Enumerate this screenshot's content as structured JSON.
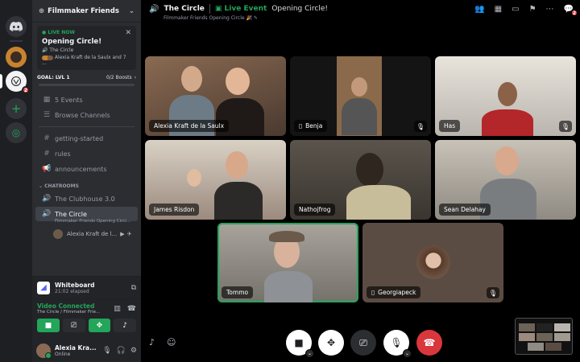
{
  "server": {
    "name": "Filmmaker Friends",
    "mention_count": "2"
  },
  "live_card": {
    "status": "LIVE NOW",
    "title": "Opening Circle!",
    "channel": "The Circle",
    "attendees": "Alexia Kraft de la Saulx and 7 ..."
  },
  "goal": {
    "label": "GOAL: LVL 1",
    "boosts": "0/2 Boosts"
  },
  "sidebar": {
    "events": "5 Events",
    "browse": "Browse Channels",
    "channels": [
      "getting-started",
      "rules",
      "announcements"
    ],
    "category": "CHATROOMS",
    "voice": [
      {
        "name": "The Clubhouse 3.0"
      },
      {
        "name": "The Circle",
        "subtitle": "Filmmaker Friends Opening Circl...",
        "member": "Alexia Kraft de l..."
      }
    ]
  },
  "whiteboard": {
    "title": "Whiteboard",
    "elapsed": "21:02 elapsed"
  },
  "voice_status": {
    "title": "Video Connected",
    "location": "The Circle / Filmmaker Frie..."
  },
  "user": {
    "name": "Alexia Kra...",
    "status": "Online"
  },
  "header": {
    "channel": "The Circle",
    "event_tag": "Live Event",
    "event_name": "Opening Circle!",
    "subtitle": "Filmmaker Friends Opening Circle 🎉",
    "inbox_count": "2"
  },
  "participants": [
    {
      "name": "Alexia Kraft de la Saulx",
      "bg": "#7a5a45"
    },
    {
      "name": "Benja",
      "bg": "#8a6a4a"
    },
    {
      "name": "Has",
      "bg": "#b9b5ae"
    },
    {
      "name": "James Risdon",
      "bg": "#9c8a7e"
    },
    {
      "name": "Nathojfrog",
      "bg": "#6a6258"
    },
    {
      "name": "Sean Delahay",
      "bg": "#a09a90"
    },
    {
      "name": "Tommo",
      "bg": "#8f8b84"
    },
    {
      "name": "Georgiapeck",
      "bg": "#5b4c43"
    }
  ],
  "icons": {
    "mute": "mic-off-icon",
    "camera": "camera-icon",
    "activities": "activities-icon",
    "screenshare": "screen-share-icon",
    "mic": "microphone-icon",
    "hangup": "hang-up-icon"
  },
  "colors": {
    "accent_green": "#23a55a",
    "danger": "#da373c",
    "blurple": "#5865f2"
  }
}
